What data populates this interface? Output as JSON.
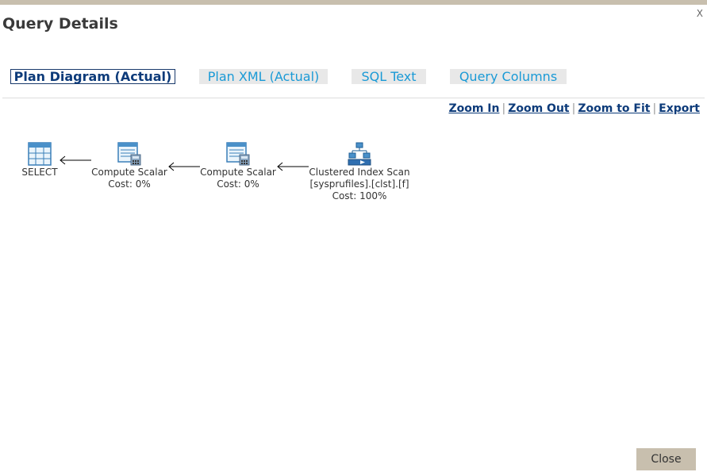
{
  "dialog": {
    "title": "Query Details",
    "close_glyph": "X",
    "close_button": "Close"
  },
  "tabs": [
    {
      "label": "Plan Diagram (Actual)",
      "active": true
    },
    {
      "label": "Plan XML (Actual)",
      "active": false
    },
    {
      "label": "SQL Text",
      "active": false
    },
    {
      "label": "Query Columns",
      "active": false
    }
  ],
  "zoom": {
    "zoom_in": "Zoom In",
    "zoom_out": "Zoom Out",
    "zoom_to_fit": "Zoom to Fit",
    "export": "Export",
    "separator": "|"
  },
  "plan": {
    "nodes": [
      {
        "icon": "select-table-icon",
        "name": "SELECT",
        "detail": "",
        "cost": ""
      },
      {
        "icon": "compute-scalar-icon",
        "name": "Compute Scalar",
        "detail": "",
        "cost": "Cost: 0%"
      },
      {
        "icon": "compute-scalar-icon",
        "name": "Compute Scalar",
        "detail": "",
        "cost": "Cost: 0%"
      },
      {
        "icon": "clustered-index-scan-icon",
        "name": "Clustered Index Scan",
        "detail": "[sysprufiles].[clst].[f]",
        "cost": "Cost: 100%"
      }
    ]
  },
  "colors": {
    "accent_bar": "#c8bfae",
    "tab_text": "#1a9ad6",
    "active_tab_text": "#0d3b7a",
    "link": "#0d3b7a"
  }
}
